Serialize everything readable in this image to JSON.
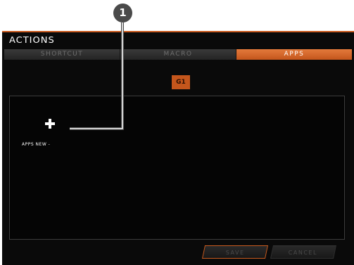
{
  "window": {
    "title": "ACTIONS",
    "accent_color": "#c85a1e"
  },
  "tabs": [
    {
      "label": "SHORTCUT",
      "active": false
    },
    {
      "label": "MACRO",
      "active": false
    },
    {
      "label": "APPS",
      "active": true
    }
  ],
  "g_key": {
    "label": "G1"
  },
  "panel": {
    "add_icon": "plus-icon",
    "apps_label": "APPS NEW -"
  },
  "buttons": {
    "save_label": "SAVE",
    "cancel_label": "CANCEL"
  },
  "callout": {
    "number": "1"
  }
}
